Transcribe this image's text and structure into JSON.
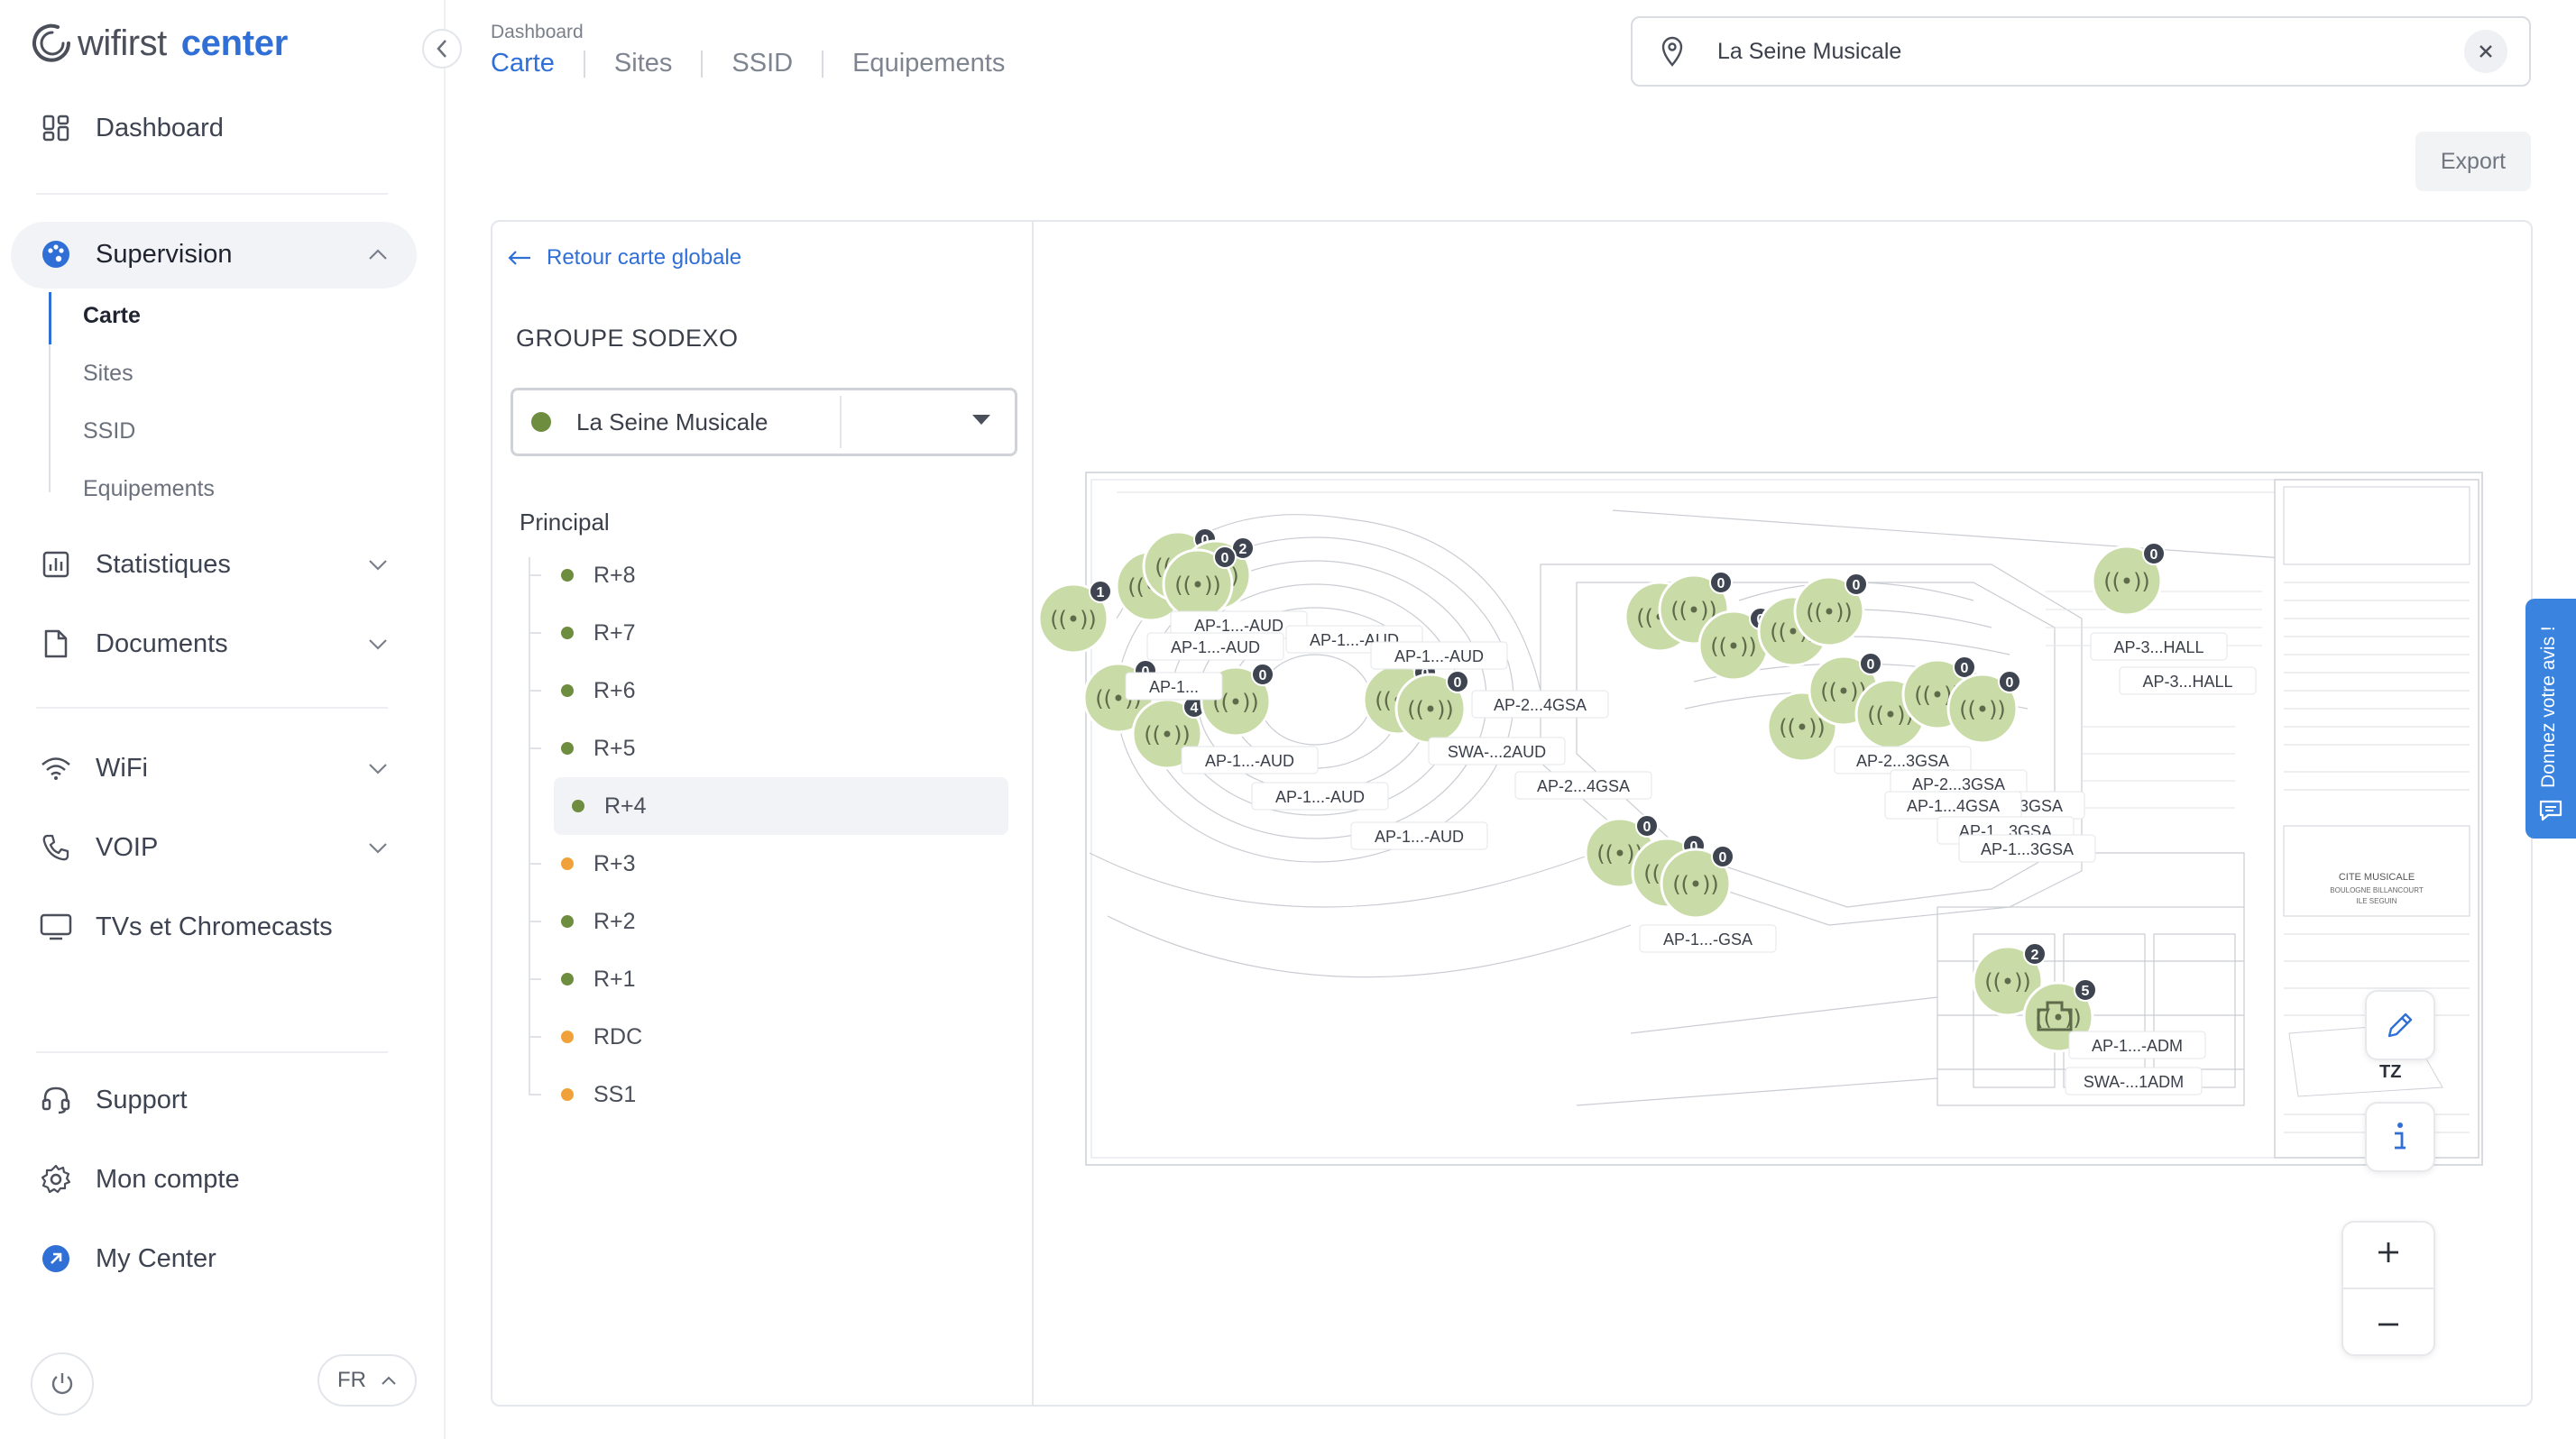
{
  "brand": {
    "word1": "wifirst",
    "word2": "center",
    "accent": "#2f6fd6"
  },
  "sidebar": {
    "dashboard": "Dashboard",
    "supervision": "Supervision",
    "supervision_items": [
      "Carte",
      "Sites",
      "SSID",
      "Equipements"
    ],
    "statistiques": "Statistiques",
    "documents": "Documents",
    "wifi": "WiFi",
    "voip": "VOIP",
    "tvs": "TVs et Chromecasts",
    "support": "Support",
    "mon_compte": "Mon compte",
    "my_center": "My Center",
    "lang": "FR"
  },
  "header": {
    "breadcrumb": "Dashboard",
    "tabs": [
      "Carte",
      "Sites",
      "SSID",
      "Equipements"
    ],
    "active_tab": "Carte",
    "search_value": "La Seine Musicale",
    "export": "Export"
  },
  "panel": {
    "back": "Retour carte globale",
    "group": "GROUPE SODEXO",
    "site_value": "La Seine Musicale",
    "principal": "Principal",
    "floors": [
      {
        "label": "R+8",
        "color": "#6e8d3e"
      },
      {
        "label": "R+7",
        "color": "#6e8d3e"
      },
      {
        "label": "R+6",
        "color": "#6e8d3e"
      },
      {
        "label": "R+5",
        "color": "#6e8d3e"
      },
      {
        "label": "R+4",
        "color": "#6e8d3e"
      },
      {
        "label": "R+3",
        "color": "#f0a23a"
      },
      {
        "label": "R+2",
        "color": "#6e8d3e"
      },
      {
        "label": "R+1",
        "color": "#6e8d3e"
      },
      {
        "label": "RDC",
        "color": "#f0a23a"
      },
      {
        "label": "SS1",
        "color": "#f0a23a"
      }
    ],
    "active_floor": "R+4"
  },
  "map": {
    "plan_title": "CITE MUSICALE",
    "plan_subtitle": "BOULOGNE BILLANCOURT",
    "plan_subtitle2": "ILE SEGUIN",
    "tz": "TZ",
    "feedback": "Donnez votre avis !",
    "labels": [
      "AP-1...-AUD",
      "AP-1...-AUD",
      "AP-1...-AUD",
      "AP-1...-AUD",
      "AP-1...-AUD",
      "AP-1...-AUD",
      "SWA-...2AUD",
      "AP-2...4GSA",
      "AP-2...4GSA",
      "AP-2...3GSA",
      "AP-2...3GSA",
      "AP-2...3GSA",
      "AP-1...4GSA",
      "AP-1...3GSA",
      "AP-1...3GSA",
      "AP-1...-GSA",
      "AP-3...HALL",
      "AP-3...HALL",
      "AP-1...-ADM",
      "SWA-...1ADM",
      "AP-1...",
      "AP-1...-AUD"
    ],
    "badge_values": [
      "1",
      "0",
      "0",
      "2",
      "0",
      "0",
      "4",
      "0",
      "0",
      "0",
      "0",
      "0",
      "0",
      "0",
      "0",
      "0",
      "0",
      "0",
      "0",
      "0",
      "0",
      "0",
      "0",
      "0",
      "2",
      "5"
    ]
  }
}
